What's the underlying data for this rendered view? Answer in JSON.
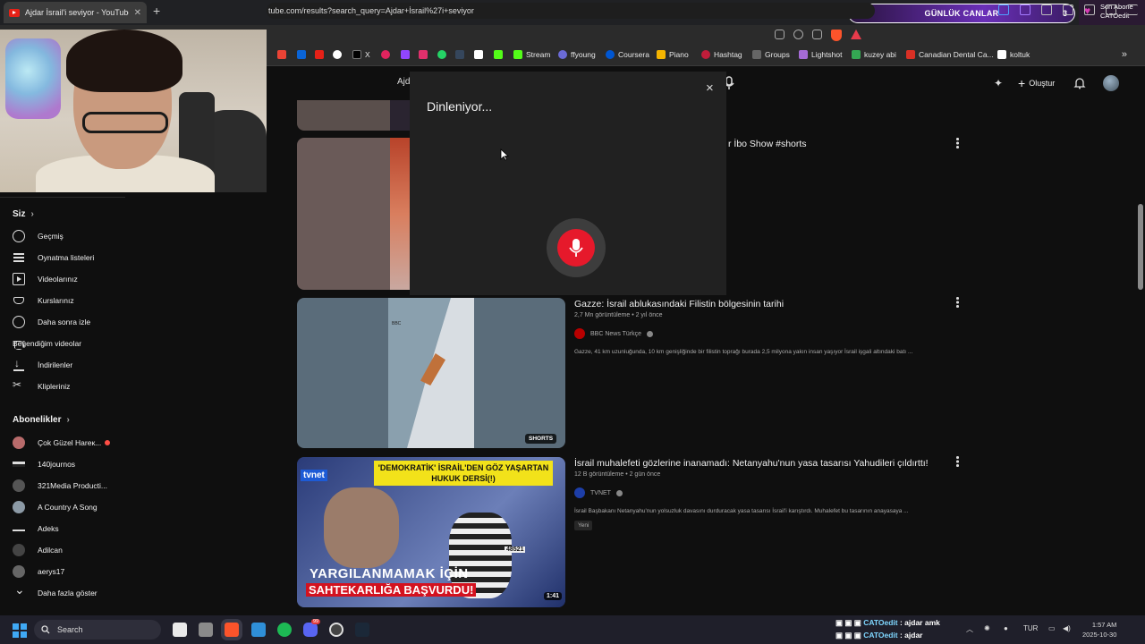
{
  "browser": {
    "tab_title": "Ajdar İsrail'i seviyor - YouTube",
    "new_tab": "+",
    "url": "tube.com/results?search_query=Ajdar+İsrail%27i+seviyor",
    "bookmarks": [
      "X",
      "Stream",
      "ffyoung",
      "Coursera",
      "Piano",
      "Hashtag",
      "Groups",
      "Lightshot",
      "kuzey abi",
      "Canadian Dental Ca...",
      "koltuk"
    ],
    "bookmarks_more": "»"
  },
  "overlay": {
    "gunluk_left": "2",
    "gunluk_label": "GÜNLÜK CANLAR",
    "gunluk_right": "3",
    "son_abone_label": "Son Abone",
    "son_abone_name": "CATOedit"
  },
  "youtube": {
    "search_prefix": "Ajd",
    "create_label": "Oluştur"
  },
  "voice_dialog": {
    "title": "Dinleniyor...",
    "close": "×",
    "accent": "#e6192b"
  },
  "sidebar": {
    "you_label": "Siz",
    "you_items": [
      "Geçmiş",
      "Oynatma listeleri",
      "Videolarınız",
      "Kurslarınız",
      "Daha sonra izle",
      "Beğendiğim videolar",
      "İndirilenler",
      "Klipleriniz"
    ],
    "subs_label": "Abonelikler",
    "subs": [
      "Çok Güzel Hareк...",
      "140journos",
      "321Media Producti...",
      "A Country A Song",
      "Adeks",
      "Adilcan",
      "aerys17"
    ],
    "show_more": "Daha fazla göster"
  },
  "results": [
    {
      "title": "r İbo Show #shorts"
    },
    {
      "title": "Gazze: İsrail ablukasındaki Filistin bölgesinin tarihi",
      "meta": "2,7 Mn görüntüleme • 2 yıl önce",
      "channel": "BBC News Türkçe",
      "desc": "Gazze, 41 km uzunluğunda, 10 km genişliğinde bir filistin toprağı burada 2,5 milyona yakın insan yaşıyor İsrail işgali altındaki batı ...",
      "badge": "SHORTS"
    },
    {
      "title": "İsrail muhalefeti gözlerine inanamadı: Netanyahu'nun yasa tasarısı Yahudileri çıldırttı!",
      "meta": "12 B görüntüleme • 2 gün önce",
      "channel": "TVNET",
      "desc": "İsrail Başbakanı Netanyahu'nun yolsuzluk davasını durduracak yasa tasarısı İsrail'i karıştırdı. Muhalefet bu tasarının anayasaya ...",
      "new_badge": "Yeni",
      "duration": "1:41",
      "thumb_banner": "'DEMOKRATİK' İSRAİL'DEN GÖZ YAŞARTAN HUKUK DERSİ(!)",
      "thumb_line1": "YARGILANMAMAK İÇİN",
      "thumb_line2": "SAHTEKARLIĞA BAŞVURDU!",
      "thumb_logo": "tvnet",
      "thumb_number": "48521"
    }
  ],
  "taskbar": {
    "search": "Search",
    "chat": [
      {
        "name": "CATOedit",
        "msg": ": ajdar amk"
      },
      {
        "name": "CATOedit",
        "msg": ": ajdar"
      }
    ],
    "lang": "TUR",
    "time": "1:57 AM",
    "date": "2025-10-30",
    "discord_badge": "99"
  }
}
